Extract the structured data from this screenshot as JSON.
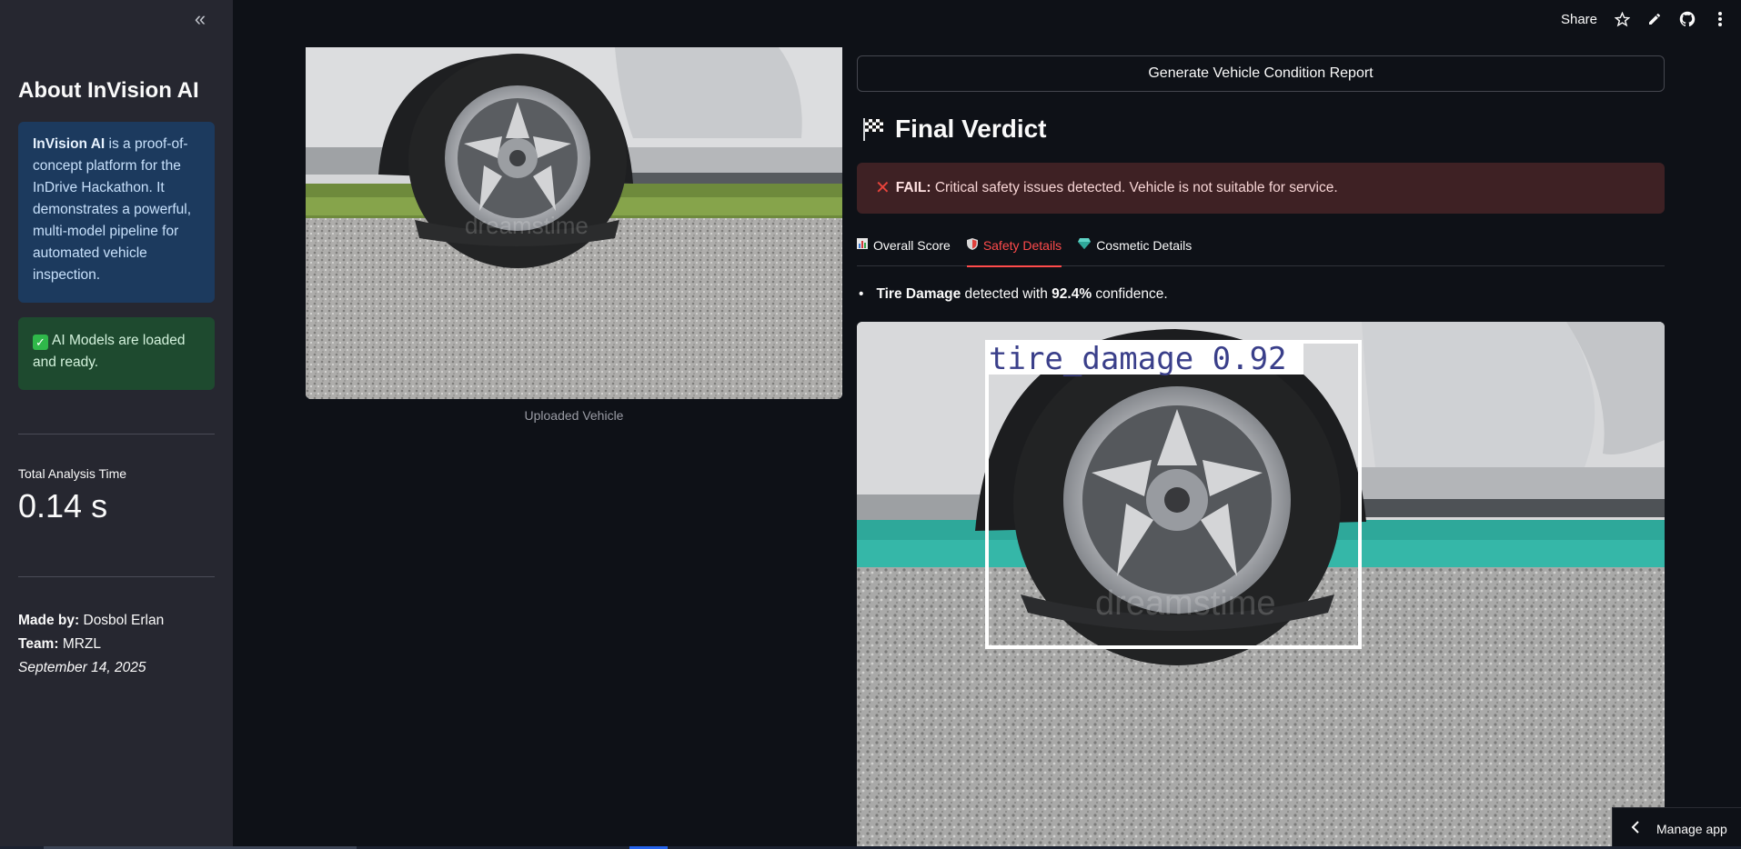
{
  "sidebar": {
    "collapse_icon": "double-chevron-left-icon",
    "title": "About InVision AI",
    "info": {
      "brand": "InVision AI",
      "text": " is a proof-of-concept platform for the InDrive Hackathon. It demonstrates a powerful, multi-model pipeline for automated vehicle inspection."
    },
    "status": "AI Models are loaded and ready.",
    "metric": {
      "label": "Total Analysis Time",
      "value": "0.14 s"
    },
    "credits": {
      "made_by_label": "Made by:",
      "made_by": " Dosbol Erlan",
      "team_label": "Team:",
      "team": " MRZL",
      "date": "September 14, 2025"
    }
  },
  "header": {
    "share_label": "Share",
    "icons": [
      "star-icon",
      "pencil-icon",
      "github-icon",
      "more-vertical-icon"
    ]
  },
  "main": {
    "upload_caption": "Uploaded Vehicle",
    "report_button": "Generate Vehicle Condition Report",
    "verdict_title": "Final Verdict",
    "verdict": {
      "label": "FAIL:",
      "text": "Critical safety issues detected. Vehicle is not suitable for service."
    },
    "tabs": [
      {
        "label": "Overall Score",
        "icon": "bar-chart-icon",
        "active": false
      },
      {
        "label": "Safety Details",
        "icon": "shield-icon",
        "active": true
      },
      {
        "label": "Cosmetic Details",
        "icon": "gem-icon",
        "active": false
      }
    ],
    "detection": {
      "name": "Tire Damage",
      "middle": " detected with ",
      "confidence": "92.4%",
      "suffix": " confidence.",
      "box_label": "tire_damage  0.92",
      "watermark": "dreamstime"
    }
  },
  "manage_app": "Manage app",
  "colors": {
    "accent": "#ff4b4b",
    "sidebar_bg": "#262730",
    "main_bg": "#0e1117",
    "info_bg": "#1c3a5e",
    "success_bg": "#1e4a2f",
    "error_bg": "#3e2124"
  }
}
